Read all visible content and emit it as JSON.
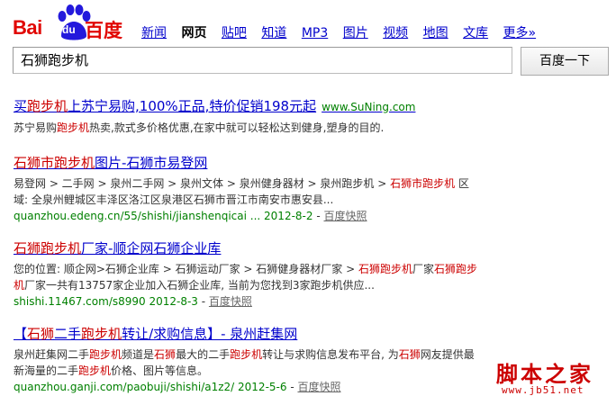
{
  "logo": {
    "bai": "Bai",
    "du": "du",
    "cn": "百度"
  },
  "nav": {
    "items": [
      "新闻",
      "网页",
      "贴吧",
      "知道",
      "MP3",
      "图片",
      "视频",
      "地图",
      "文库",
      "更多»"
    ],
    "active_index": 1
  },
  "search": {
    "query": "石狮跑步机",
    "button": "百度一下"
  },
  "ad": {
    "title_pre": "买",
    "title_kw": "跑步机",
    "title_post": "上苏宁易购,100%正品,特价促销198元起",
    "url": "www.SuNing.com",
    "abs_pre": "苏宁易购",
    "abs_kw": "跑步机",
    "abs_post": "热卖,款式多价格优惠,在家中就可以轻松达到健身,塑身的目的."
  },
  "results": [
    {
      "title_kw": "石狮市跑步机",
      "title_post": "图片-石狮市易登网",
      "abs_line1_pre": "易登网 > 二手网 > 泉州二手网 > 泉州文体 > 泉州健身器材 > 泉州跑步机 > ",
      "abs_line1_kw": "石狮市跑步机",
      "abs_line1_post": " 区",
      "abs_line2": "域: 全泉州鲤城区丰泽区洛江区泉港区石狮市晋江市南安市惠安县...",
      "cite": "quanzhou.edeng.cn/55/shishi/jianshenqicai ... 2012-8-2",
      "snap": "百度快照"
    },
    {
      "title_kw": "石狮跑步机",
      "title_post": "厂家-顺企网石狮企业库",
      "abs_line1_pre": "您的位置: 顺企网>石狮企业库 > 石狮运动厂家 > 石狮健身器材厂家 > ",
      "abs_line1_kw": "石狮跑步机",
      "abs_line1_mid": "厂家",
      "abs_line1_kw2": "石狮跑步",
      "abs_line2_kw": "机",
      "abs_line2": "厂家一共有13757家企业加入石狮企业库, 当前为您找到3家跑步机供应...",
      "cite": "shishi.11467.com/s8990 2012-8-3",
      "snap": "百度快照"
    },
    {
      "title_pre": "【",
      "title_kw1": "石狮",
      "title_mid": "二手",
      "title_kw2": "跑步机",
      "title_post": "转让/求购信息】- 泉州赶集网",
      "abs_line1_pre": "泉州赶集网二手",
      "abs_line1_kw": "跑步机",
      "abs_line1_mid": "频道是",
      "abs_line1_kw2": "石狮",
      "abs_line1_mid2": "最大的二手",
      "abs_line1_kw3": "跑步机",
      "abs_line1_mid3": "转让与求购信息发布平台, 为",
      "abs_line1_kw4": "石狮",
      "abs_line1_post": "网友提供最",
      "abs_line2_pre": "新海量的二手",
      "abs_line2_kw": "跑步机",
      "abs_line2_post": "价格、图片等信息。",
      "cite": "quanzhou.ganji.com/paobuji/shishi/a1z2/ 2012-5-6",
      "snap": "百度快照"
    }
  ],
  "watermark": {
    "cn": "脚本之家",
    "url": "www.jb51.net"
  },
  "colors": {
    "brand": "#e10602",
    "link": "#0000cc",
    "keyword": "#cc0000",
    "url": "#008000"
  }
}
